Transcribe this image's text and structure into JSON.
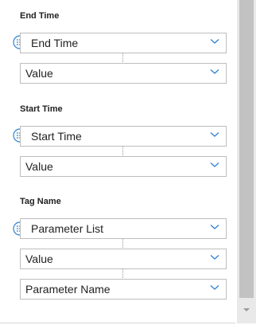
{
  "sections": {
    "end_time": {
      "title": "End Time",
      "parameter_field": "End Time",
      "value_field": "Value"
    },
    "start_time": {
      "title": "Start Time",
      "parameter_field": "Start Time",
      "value_field": "Value"
    },
    "tag_name": {
      "title": "Tag Name",
      "parameter_field": "Parameter List",
      "value_field": "Value",
      "name_field": "Parameter Name"
    }
  },
  "icons": {
    "list": "list-icon",
    "dropdown": "chevron-down-icon",
    "scroll_down": "scroll-down-arrow"
  },
  "colors": {
    "accent": "#2d7fd3",
    "field_border": "#bdbdbd",
    "scrollbar_track": "#e9e9e9",
    "scrollbar_thumb": "#c2c2c2"
  }
}
